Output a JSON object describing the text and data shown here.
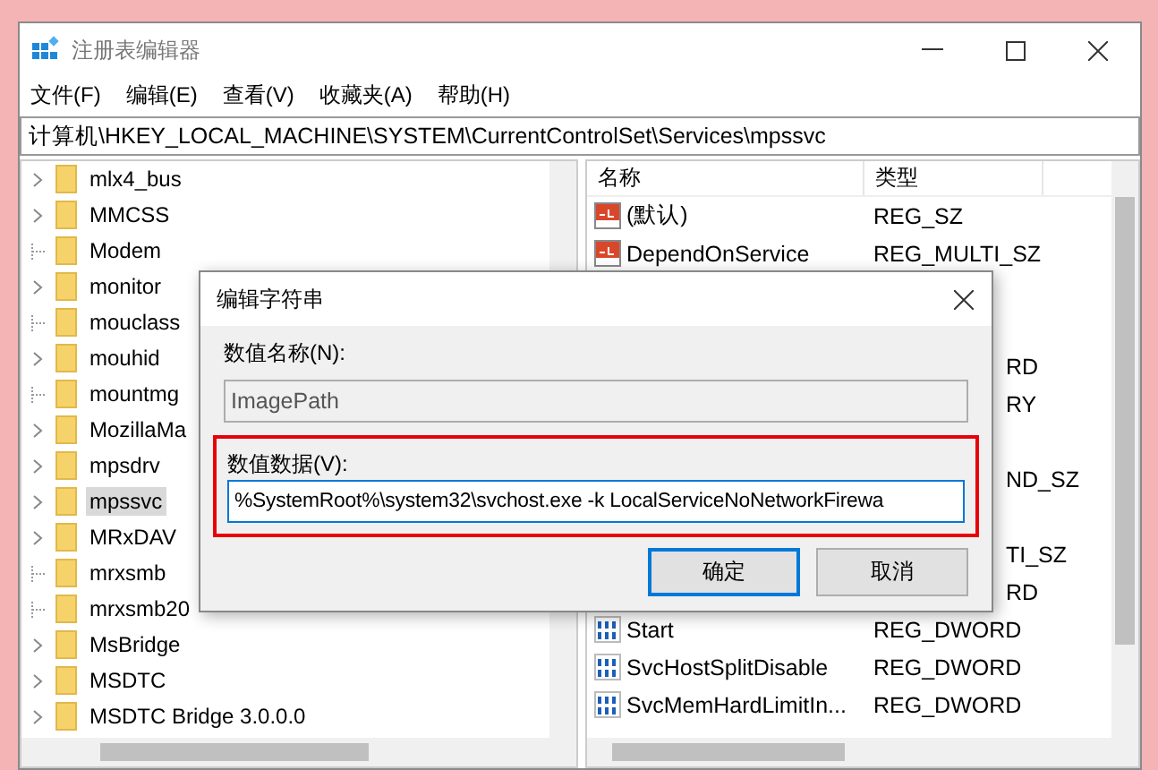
{
  "window": {
    "title": "注册表编辑器"
  },
  "menu": [
    "文件(F)",
    "编辑(E)",
    "查看(V)",
    "收藏夹(A)",
    "帮助(H)"
  ],
  "address": "计算机\\HKEY_LOCAL_MACHINE\\SYSTEM\\CurrentControlSet\\Services\\mpssvc",
  "tree": [
    {
      "label": "mlx4_bus",
      "expandable": true,
      "selected": false
    },
    {
      "label": "MMCSS",
      "expandable": true,
      "selected": false
    },
    {
      "label": "Modem",
      "expandable": false,
      "selected": false
    },
    {
      "label": "monitor",
      "expandable": true,
      "selected": false
    },
    {
      "label": "mouclass",
      "expandable": false,
      "selected": false
    },
    {
      "label": "mouhid",
      "expandable": true,
      "selected": false
    },
    {
      "label": "mountmg",
      "expandable": false,
      "selected": false
    },
    {
      "label": "MozillaMa",
      "expandable": true,
      "selected": false
    },
    {
      "label": "mpsdrv",
      "expandable": true,
      "selected": false
    },
    {
      "label": "mpssvc",
      "expandable": true,
      "selected": true
    },
    {
      "label": "MRxDAV",
      "expandable": true,
      "selected": false
    },
    {
      "label": "mrxsmb",
      "expandable": false,
      "selected": false
    },
    {
      "label": "mrxsmb20",
      "expandable": false,
      "selected": false
    },
    {
      "label": "MsBridge",
      "expandable": true,
      "selected": false
    },
    {
      "label": "MSDTC",
      "expandable": true,
      "selected": false
    },
    {
      "label": "MSDTC Bridge 3.0.0.0",
      "expandable": true,
      "selected": false
    }
  ],
  "columns": [
    "名称",
    "类型"
  ],
  "values": [
    {
      "kind": "string",
      "name": "(默认)",
      "type": "REG_SZ"
    },
    {
      "kind": "string",
      "name": "DependOnService",
      "type": "REG_MULTI_SZ"
    },
    {
      "kind": "covered"
    },
    {
      "kind": "covered"
    },
    {
      "kind": "covered",
      "type_tail": "RD"
    },
    {
      "kind": "covered",
      "type_tail": "RY"
    },
    {
      "kind": "covered"
    },
    {
      "kind": "covered",
      "type_tail": "ND_SZ"
    },
    {
      "kind": "covered"
    },
    {
      "kind": "covered",
      "type_tail": "TI_SZ"
    },
    {
      "kind": "covered",
      "type_tail": "RD"
    },
    {
      "kind": "binary",
      "name": "Start",
      "type": "REG_DWORD"
    },
    {
      "kind": "binary",
      "name": "SvcHostSplitDisable",
      "type": "REG_DWORD"
    },
    {
      "kind": "binary",
      "name": "SvcMemHardLimitIn...",
      "type": "REG_DWORD"
    }
  ],
  "dialog": {
    "title": "编辑字符串",
    "name_label": "数值名称(N):",
    "name_value": "ImagePath",
    "data_label": "数值数据(V):",
    "data_value": "%SystemRoot%\\system32\\svchost.exe -k LocalServiceNoNetworkFirewa",
    "highlighted": true,
    "buttons": [
      {
        "label": "确定",
        "default": true
      },
      {
        "label": "取消",
        "default": false
      }
    ]
  }
}
